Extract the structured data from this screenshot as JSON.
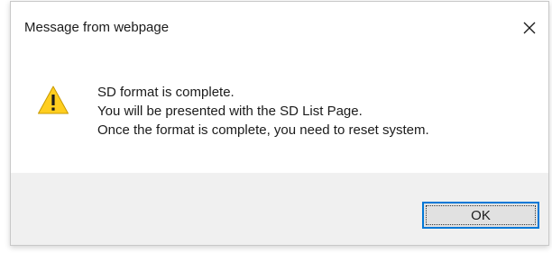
{
  "dialog": {
    "title": "Message from webpage",
    "close_icon": "close-icon",
    "warning_icon": "warning-triangle-icon",
    "message_lines": [
      "SD format is complete.",
      "You will be presented with the SD List Page.",
      "Once the format is complete, you need to reset system."
    ],
    "ok_label": "OK"
  },
  "colors": {
    "accent": "#0078d7",
    "footer_bg": "#f0f0f0",
    "warning_yellow": "#ffce1f",
    "button_bg": "#e1e1e1"
  }
}
